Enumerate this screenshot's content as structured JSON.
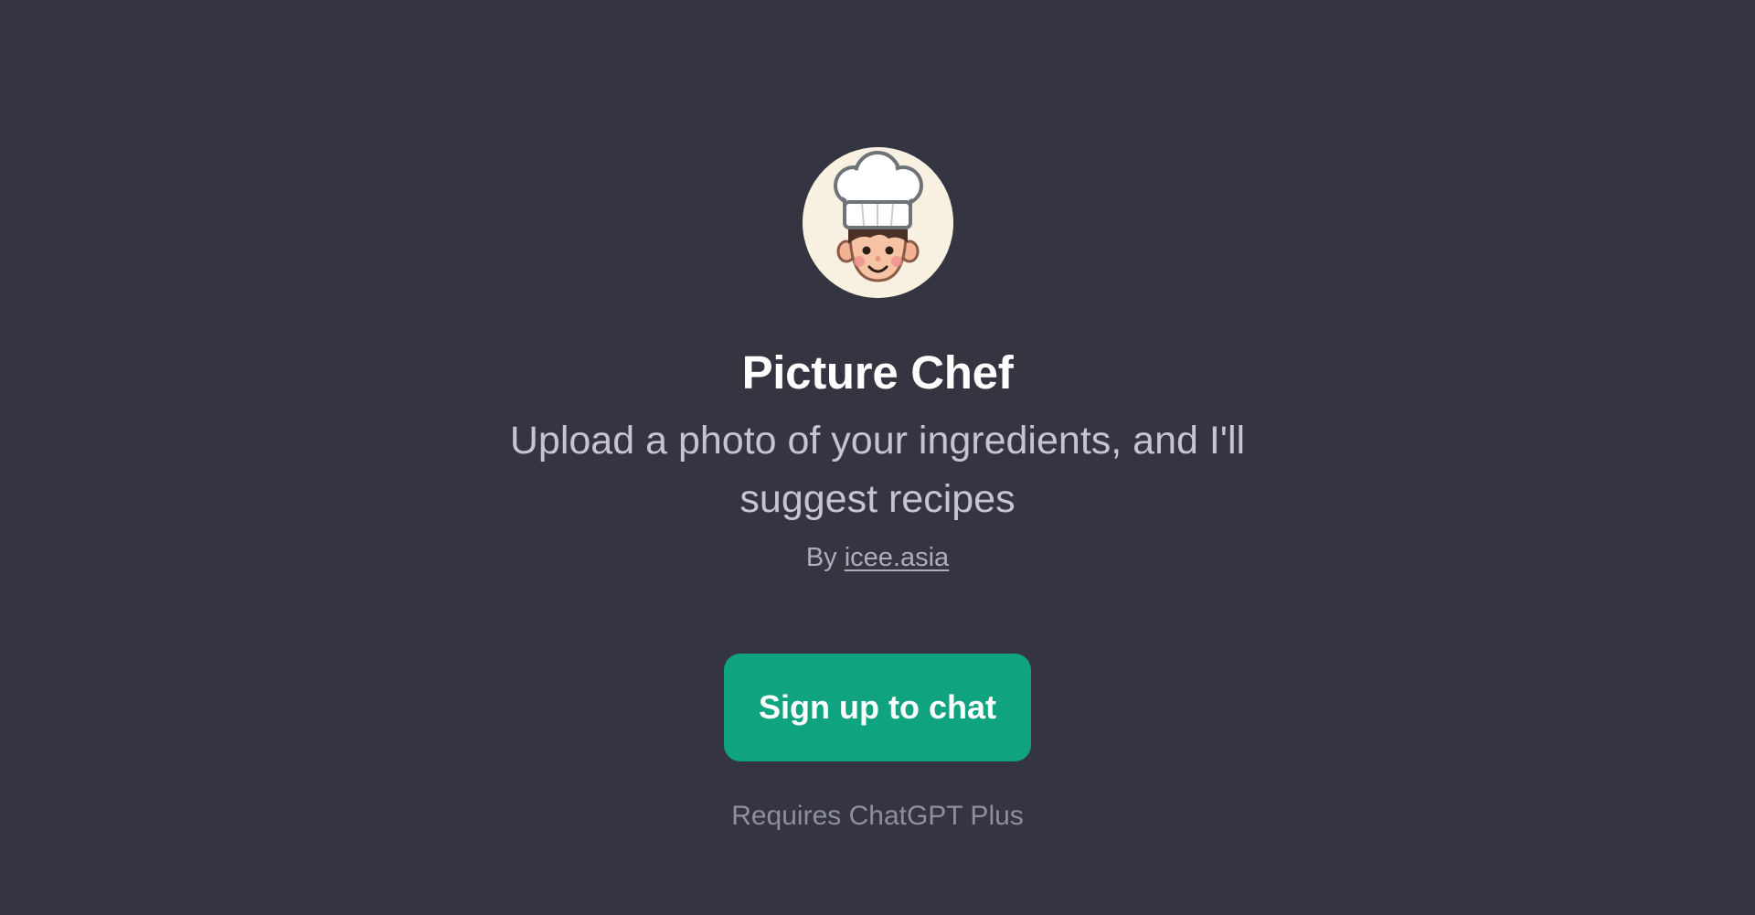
{
  "gpt": {
    "avatar_icon": "chef-avatar-icon",
    "title": "Picture Chef",
    "description": "Upload a photo of your ingredients, and I'll suggest recipes",
    "by_prefix": "By",
    "author": "icee.asia"
  },
  "actions": {
    "signup_label": "Sign up to chat",
    "requires_note": "Requires ChatGPT Plus"
  },
  "colors": {
    "background": "#343541",
    "accent": "#10a37f",
    "title": "#ffffff",
    "description": "#c5c5d2",
    "muted": "#8e8ea0"
  }
}
